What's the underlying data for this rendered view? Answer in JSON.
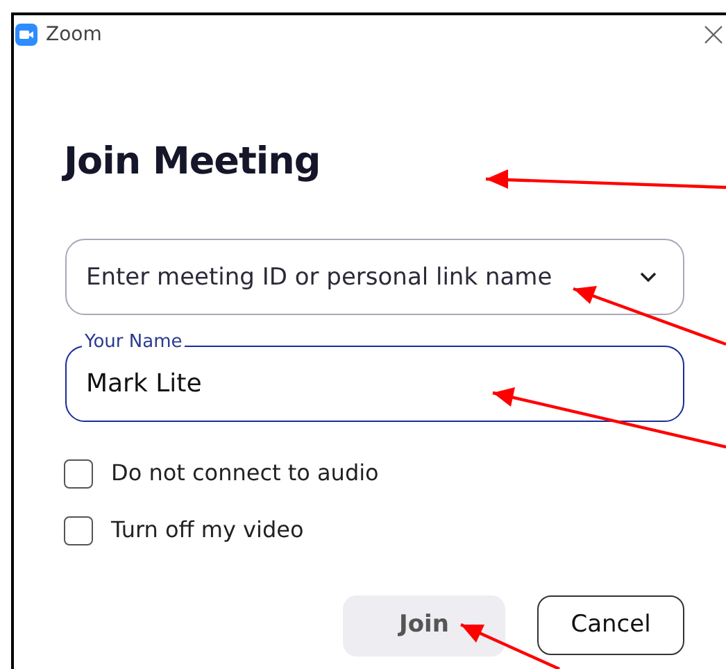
{
  "window": {
    "title": "Zoom"
  },
  "heading": "Join Meeting",
  "meeting_field": {
    "placeholder": "Enter meeting ID or personal link name"
  },
  "name_field": {
    "label": "Your Name",
    "value": "Mark Lite",
    "focused": true
  },
  "options": [
    {
      "label": "Do not connect to audio",
      "checked": false
    },
    {
      "label": "Turn off my video",
      "checked": false
    }
  ],
  "buttons": [
    {
      "label": "Join",
      "disabled": true
    },
    {
      "label": "Cancel",
      "disabled": false
    }
  ]
}
